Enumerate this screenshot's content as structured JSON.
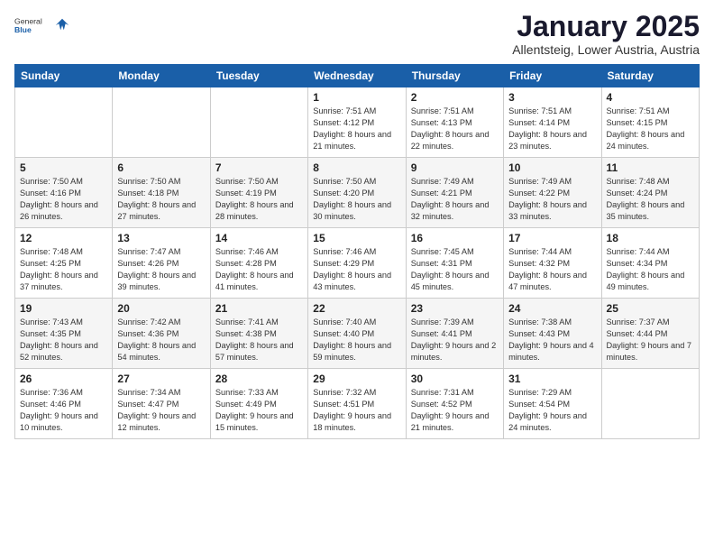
{
  "header": {
    "logo_general": "General",
    "logo_blue": "Blue",
    "month": "January 2025",
    "location": "Allentsteig, Lower Austria, Austria"
  },
  "calendar": {
    "days_of_week": [
      "Sunday",
      "Monday",
      "Tuesday",
      "Wednesday",
      "Thursday",
      "Friday",
      "Saturday"
    ],
    "weeks": [
      [
        {
          "day": "",
          "content": ""
        },
        {
          "day": "",
          "content": ""
        },
        {
          "day": "",
          "content": ""
        },
        {
          "day": "1",
          "content": "Sunrise: 7:51 AM\nSunset: 4:12 PM\nDaylight: 8 hours and 21 minutes."
        },
        {
          "day": "2",
          "content": "Sunrise: 7:51 AM\nSunset: 4:13 PM\nDaylight: 8 hours and 22 minutes."
        },
        {
          "day": "3",
          "content": "Sunrise: 7:51 AM\nSunset: 4:14 PM\nDaylight: 8 hours and 23 minutes."
        },
        {
          "day": "4",
          "content": "Sunrise: 7:51 AM\nSunset: 4:15 PM\nDaylight: 8 hours and 24 minutes."
        }
      ],
      [
        {
          "day": "5",
          "content": "Sunrise: 7:50 AM\nSunset: 4:16 PM\nDaylight: 8 hours and 26 minutes."
        },
        {
          "day": "6",
          "content": "Sunrise: 7:50 AM\nSunset: 4:18 PM\nDaylight: 8 hours and 27 minutes."
        },
        {
          "day": "7",
          "content": "Sunrise: 7:50 AM\nSunset: 4:19 PM\nDaylight: 8 hours and 28 minutes."
        },
        {
          "day": "8",
          "content": "Sunrise: 7:50 AM\nSunset: 4:20 PM\nDaylight: 8 hours and 30 minutes."
        },
        {
          "day": "9",
          "content": "Sunrise: 7:49 AM\nSunset: 4:21 PM\nDaylight: 8 hours and 32 minutes."
        },
        {
          "day": "10",
          "content": "Sunrise: 7:49 AM\nSunset: 4:22 PM\nDaylight: 8 hours and 33 minutes."
        },
        {
          "day": "11",
          "content": "Sunrise: 7:48 AM\nSunset: 4:24 PM\nDaylight: 8 hours and 35 minutes."
        }
      ],
      [
        {
          "day": "12",
          "content": "Sunrise: 7:48 AM\nSunset: 4:25 PM\nDaylight: 8 hours and 37 minutes."
        },
        {
          "day": "13",
          "content": "Sunrise: 7:47 AM\nSunset: 4:26 PM\nDaylight: 8 hours and 39 minutes."
        },
        {
          "day": "14",
          "content": "Sunrise: 7:46 AM\nSunset: 4:28 PM\nDaylight: 8 hours and 41 minutes."
        },
        {
          "day": "15",
          "content": "Sunrise: 7:46 AM\nSunset: 4:29 PM\nDaylight: 8 hours and 43 minutes."
        },
        {
          "day": "16",
          "content": "Sunrise: 7:45 AM\nSunset: 4:31 PM\nDaylight: 8 hours and 45 minutes."
        },
        {
          "day": "17",
          "content": "Sunrise: 7:44 AM\nSunset: 4:32 PM\nDaylight: 8 hours and 47 minutes."
        },
        {
          "day": "18",
          "content": "Sunrise: 7:44 AM\nSunset: 4:34 PM\nDaylight: 8 hours and 49 minutes."
        }
      ],
      [
        {
          "day": "19",
          "content": "Sunrise: 7:43 AM\nSunset: 4:35 PM\nDaylight: 8 hours and 52 minutes."
        },
        {
          "day": "20",
          "content": "Sunrise: 7:42 AM\nSunset: 4:36 PM\nDaylight: 8 hours and 54 minutes."
        },
        {
          "day": "21",
          "content": "Sunrise: 7:41 AM\nSunset: 4:38 PM\nDaylight: 8 hours and 57 minutes."
        },
        {
          "day": "22",
          "content": "Sunrise: 7:40 AM\nSunset: 4:40 PM\nDaylight: 8 hours and 59 minutes."
        },
        {
          "day": "23",
          "content": "Sunrise: 7:39 AM\nSunset: 4:41 PM\nDaylight: 9 hours and 2 minutes."
        },
        {
          "day": "24",
          "content": "Sunrise: 7:38 AM\nSunset: 4:43 PM\nDaylight: 9 hours and 4 minutes."
        },
        {
          "day": "25",
          "content": "Sunrise: 7:37 AM\nSunset: 4:44 PM\nDaylight: 9 hours and 7 minutes."
        }
      ],
      [
        {
          "day": "26",
          "content": "Sunrise: 7:36 AM\nSunset: 4:46 PM\nDaylight: 9 hours and 10 minutes."
        },
        {
          "day": "27",
          "content": "Sunrise: 7:34 AM\nSunset: 4:47 PM\nDaylight: 9 hours and 12 minutes."
        },
        {
          "day": "28",
          "content": "Sunrise: 7:33 AM\nSunset: 4:49 PM\nDaylight: 9 hours and 15 minutes."
        },
        {
          "day": "29",
          "content": "Sunrise: 7:32 AM\nSunset: 4:51 PM\nDaylight: 9 hours and 18 minutes."
        },
        {
          "day": "30",
          "content": "Sunrise: 7:31 AM\nSunset: 4:52 PM\nDaylight: 9 hours and 21 minutes."
        },
        {
          "day": "31",
          "content": "Sunrise: 7:29 AM\nSunset: 4:54 PM\nDaylight: 9 hours and 24 minutes."
        },
        {
          "day": "",
          "content": ""
        }
      ]
    ]
  }
}
